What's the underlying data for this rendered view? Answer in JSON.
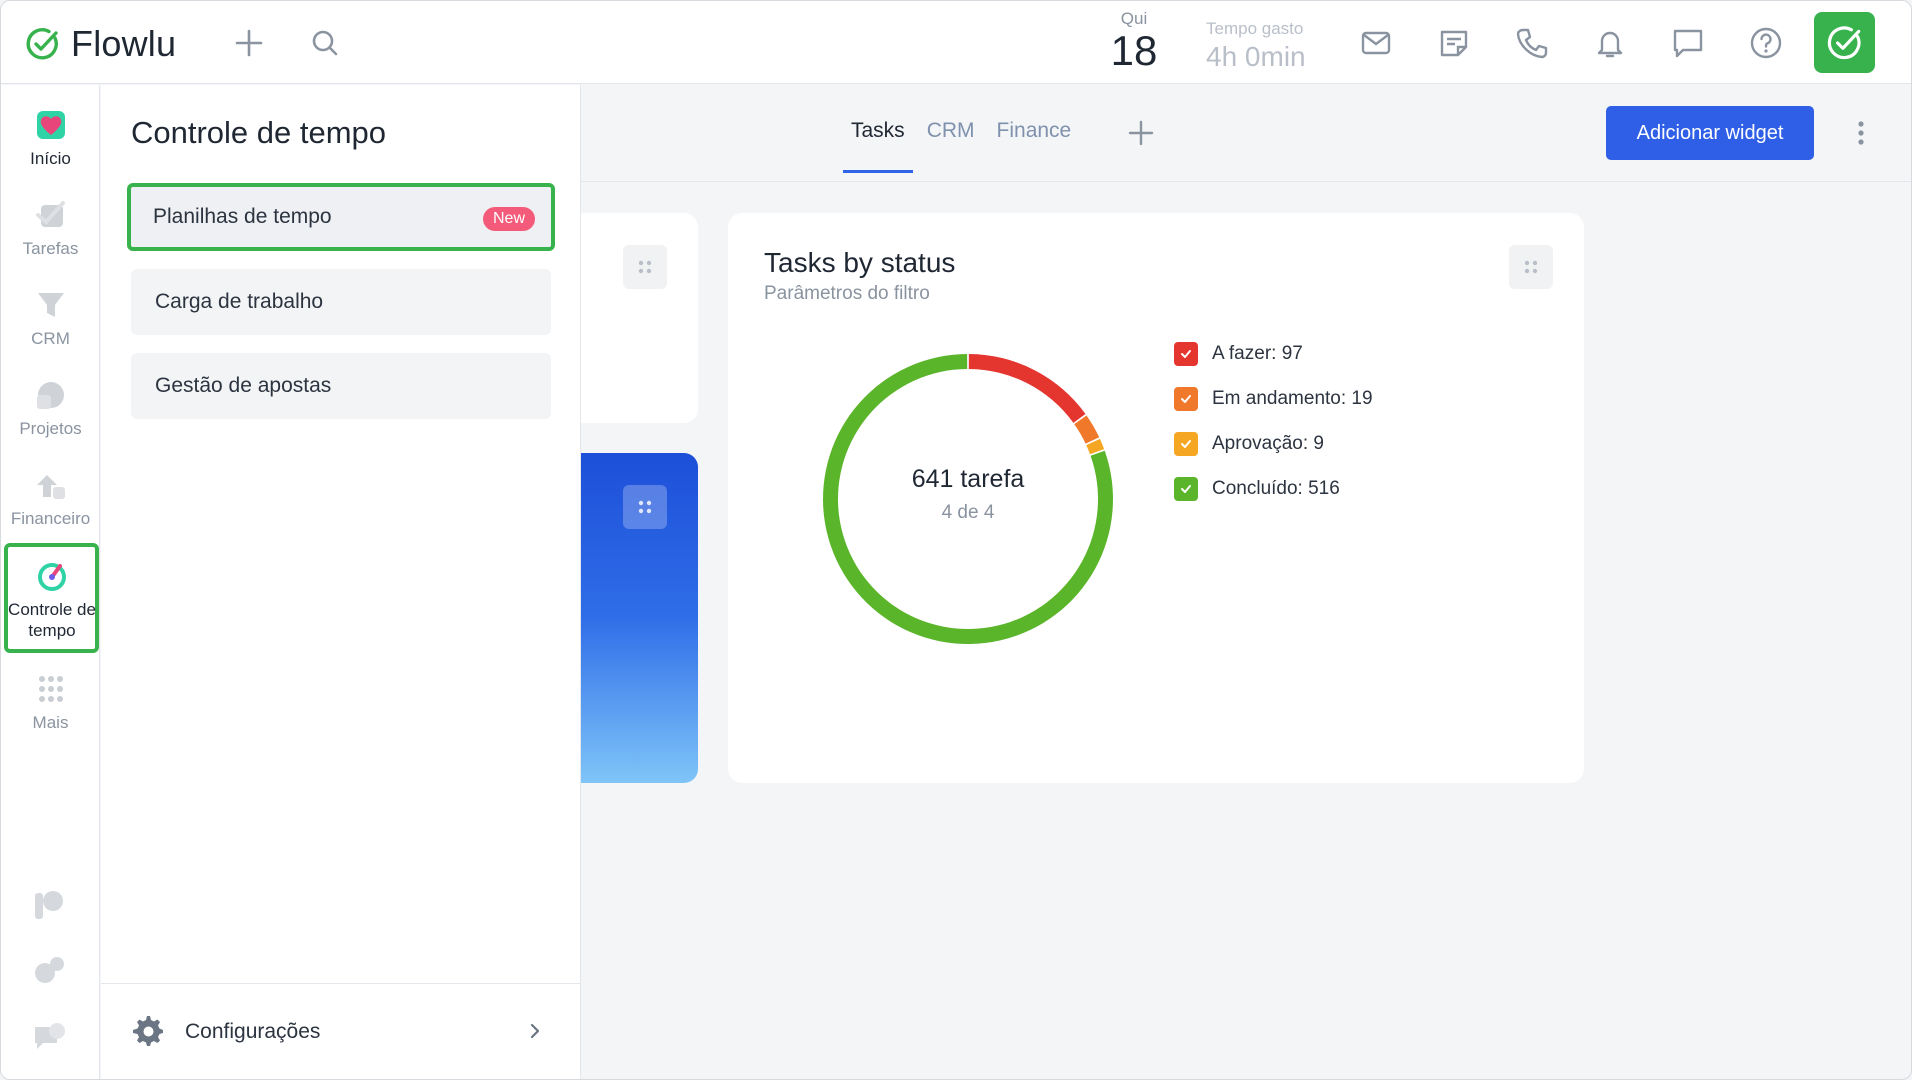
{
  "app": {
    "logo_text": "Flowlu",
    "brand_color": "#37b24d",
    "accent_color": "#2f5fe6"
  },
  "topbar": {
    "date_day": "Qui",
    "date_num": "18",
    "time_label": "Tempo gasto",
    "time_value": "4h 0min",
    "icons": [
      "plus-icon",
      "search-icon",
      "mail-icon",
      "notes-icon",
      "phone-icon",
      "bell-icon",
      "chat-icon",
      "help-icon",
      "check-icon"
    ]
  },
  "rail": {
    "items": [
      {
        "label": "Início",
        "icon": "home-icon"
      },
      {
        "label": "Tarefas",
        "icon": "tasks-icon"
      },
      {
        "label": "CRM",
        "icon": "crm-icon"
      },
      {
        "label": "Projetos",
        "icon": "projects-icon"
      },
      {
        "label": "Financeiro",
        "icon": "finance-icon"
      },
      {
        "label": "Controle de tempo",
        "icon": "timer-icon"
      },
      {
        "label": "Mais",
        "icon": "grid-icon"
      }
    ]
  },
  "panel": {
    "title": "Controle de tempo",
    "items": [
      {
        "label": "Planilhas de tempo",
        "badge": "New"
      },
      {
        "label": "Carga de trabalho"
      },
      {
        "label": "Gestão de apostas"
      }
    ],
    "footer_label": "Configurações"
  },
  "main": {
    "tabs": [
      "Tasks",
      "CRM",
      "Finance"
    ],
    "active_tab": "Tasks",
    "add_widget_label": "Adicionar widget"
  },
  "widget": {
    "title": "Tasks by status",
    "subtitle": "Parâmetros do filtro",
    "center_main": "641 tarefa",
    "center_sub": "4 de 4",
    "legend": [
      {
        "label": "A fazer: 97",
        "color": "#e5352f"
      },
      {
        "label": "Em andamento: 19",
        "color": "#f0782a"
      },
      {
        "label": "Aprovação: 9",
        "color": "#f5a623"
      },
      {
        "label": "Concluído: 516",
        "color": "#5bb52a"
      }
    ]
  },
  "chart_data": {
    "type": "pie",
    "categories": [
      "A fazer",
      "Em andamento",
      "Aprovação",
      "Concluído"
    ],
    "values": [
      97,
      19,
      9,
      516
    ],
    "colors": [
      "#e5352f",
      "#f0782a",
      "#f5a623",
      "#5bb52a"
    ],
    "title": "Tasks by status",
    "legend": "right"
  }
}
